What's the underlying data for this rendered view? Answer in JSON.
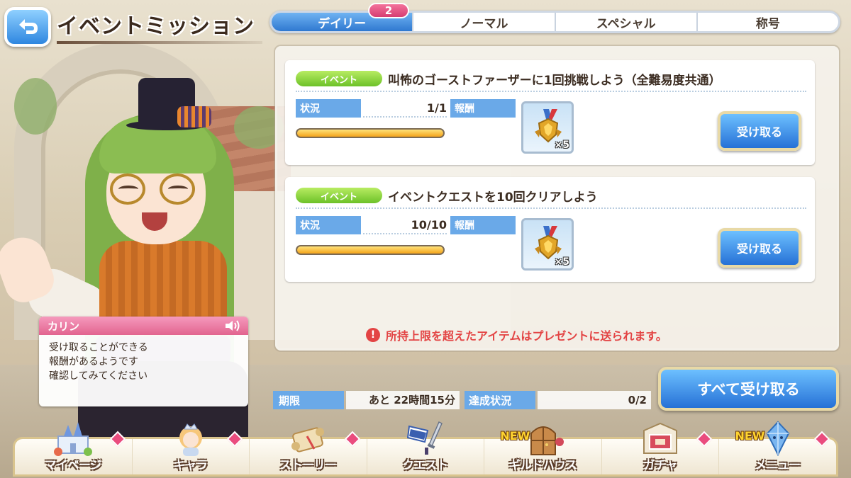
{
  "header": {
    "title": "イベントミッション"
  },
  "tabs": [
    {
      "label": "デイリー",
      "active": true
    },
    {
      "label": "ノーマル",
      "active": false
    },
    {
      "label": "スペシャル",
      "active": false
    },
    {
      "label": "称号",
      "active": false
    }
  ],
  "tab_badge": "2",
  "missions": [
    {
      "tag": "イベント",
      "title": "叫怖のゴーストファーザーに1回挑戦しよう（全難易度共通）",
      "status_label": "状況",
      "progress": "1/1",
      "progress_fraction": 1.0,
      "reward_label": "報酬",
      "reward_icon": "medal-icon",
      "reward_quantity": "×5",
      "claim_label": "受け取る"
    },
    {
      "tag": "イベント",
      "title": "イベントクエストを10回クリアしよう",
      "status_label": "状況",
      "progress": "10/10",
      "progress_fraction": 1.0,
      "reward_label": "報酬",
      "reward_icon": "medal-icon",
      "reward_quantity": "×5",
      "claim_label": "受け取る"
    }
  ],
  "warning": "所持上限を超えたアイテムはプレゼントに送られます。",
  "dialogue": {
    "speaker": "カリン",
    "lines": [
      "受け取ることができる",
      "報酬があるようです",
      "確認してみてください"
    ]
  },
  "deadline": {
    "label": "期限",
    "value": "あと 22時間15分"
  },
  "achievement": {
    "label": "達成状況",
    "value": "0/2"
  },
  "claim_all_label": "すべて受け取る",
  "nav": [
    {
      "label": "マイページ",
      "icon": "castle-icon",
      "diamond": true,
      "new": false
    },
    {
      "label": "キャラ",
      "icon": "character-icon",
      "diamond": true,
      "new": false
    },
    {
      "label": "ストーリー",
      "icon": "scroll-icon",
      "diamond": true,
      "new": false
    },
    {
      "label": "クエスト",
      "icon": "sword-flag-icon",
      "diamond": false,
      "new": false
    },
    {
      "label": "ギルドハウス",
      "icon": "door-icon",
      "diamond": false,
      "new": true
    },
    {
      "label": "ガチャ",
      "icon": "gacha-icon",
      "diamond": true,
      "new": false
    },
    {
      "label": "メニュー",
      "icon": "crystal-icon",
      "diamond": true,
      "new": true
    }
  ],
  "new_label": "NEW",
  "colors": {
    "accent_blue": "#2f78d0",
    "event_green": "#6cc128",
    "warning_red": "#e34444",
    "speaker_pink": "#e2648f"
  }
}
